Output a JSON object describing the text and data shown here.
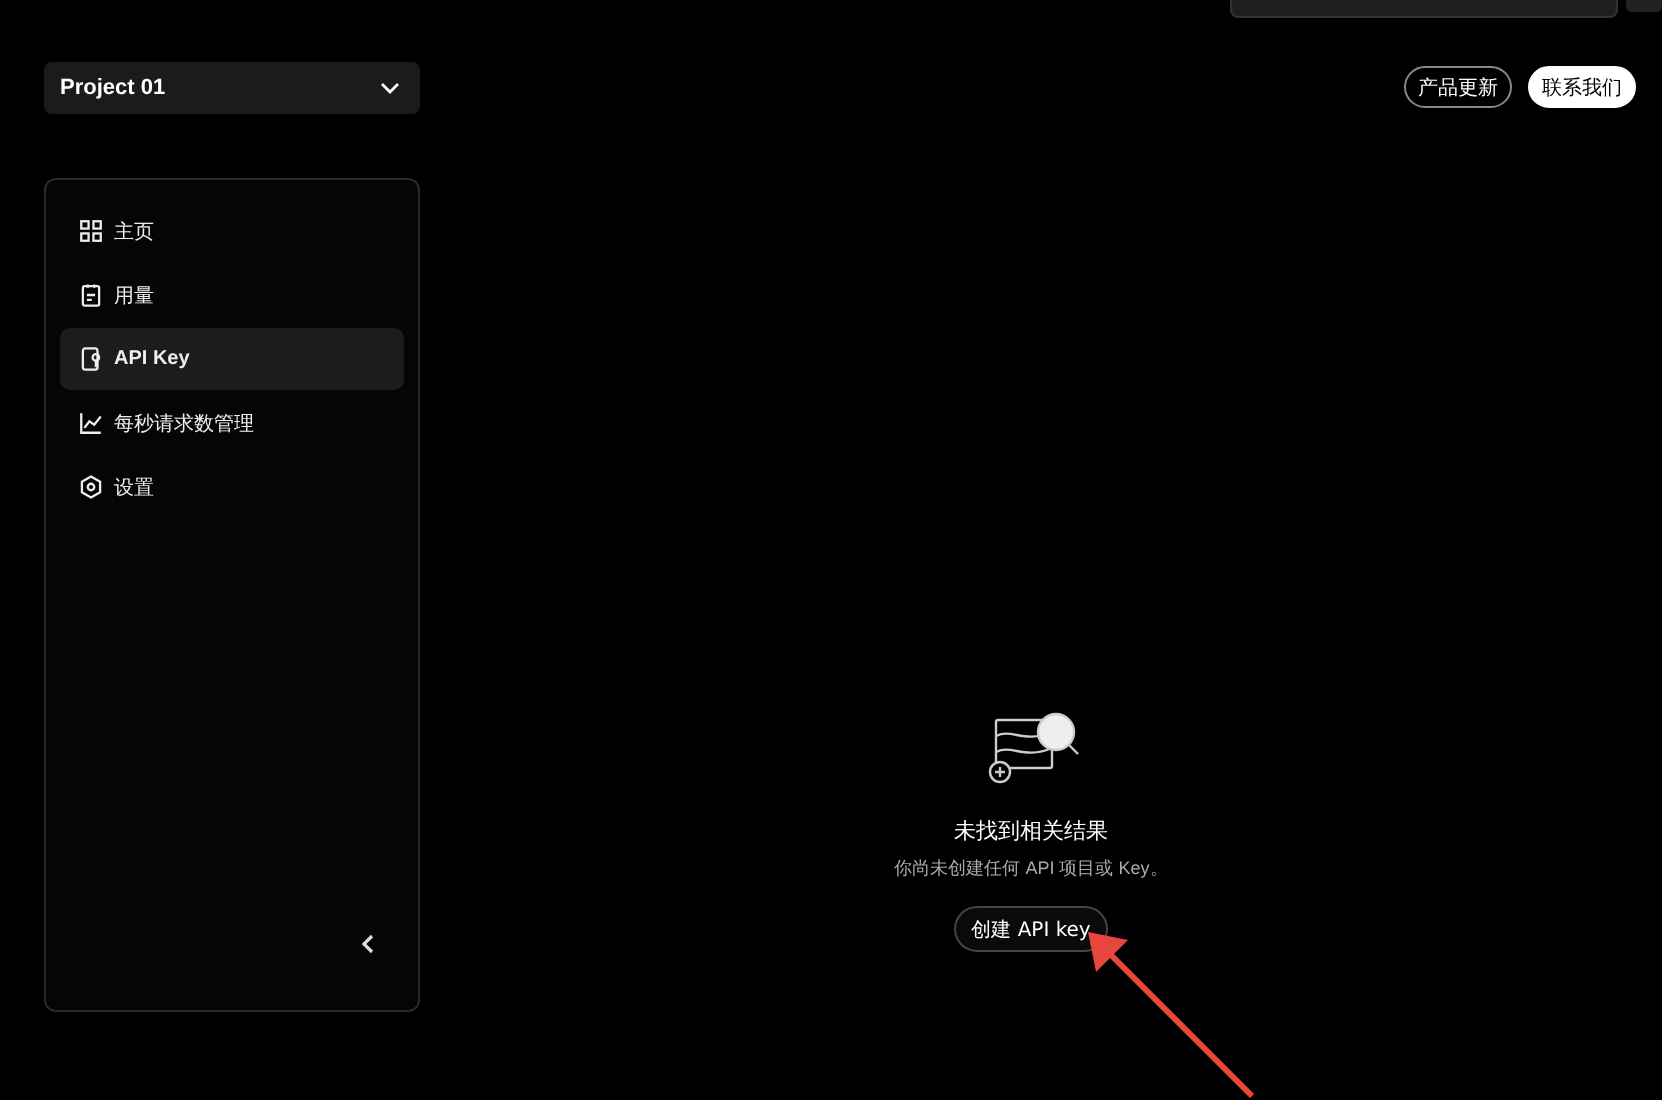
{
  "project_select": {
    "value": "Project 01"
  },
  "header_buttons": [
    {
      "label": "产品更新",
      "kind": "outline"
    },
    {
      "label": "联系我们",
      "kind": "filled"
    }
  ],
  "sidebar": {
    "items": [
      {
        "label": "主页",
        "selected": false
      },
      {
        "label": "用量",
        "selected": false
      },
      {
        "label": "API Key",
        "selected": true
      },
      {
        "label": "每秒请求数管理",
        "selected": false
      },
      {
        "label": "设置",
        "selected": false
      }
    ]
  },
  "empty_state": {
    "title": "未找到相关结果",
    "subtitle": "你尚未创建任何 API 项目或 Key。",
    "button": "创建 API key"
  }
}
